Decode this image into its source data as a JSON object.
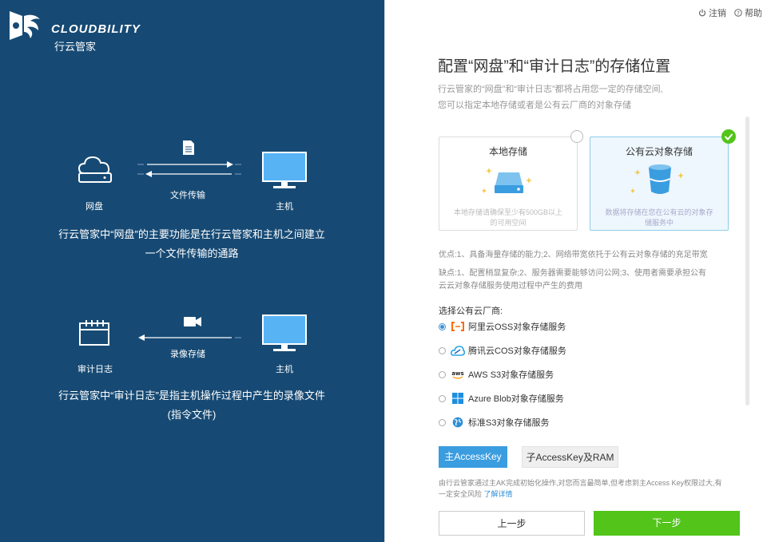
{
  "brand": {
    "name_en": "CLOUDBILITY",
    "name_cn": "行云管家"
  },
  "left": {
    "disk_flow": {
      "left_label": "网盘",
      "arrow_label": "文件传输",
      "right_label": "主机",
      "desc_line1": "行云管家中“网盘”的主要功能是在行云管家和主机之间建立",
      "desc_line2": "一个文件传输的通路"
    },
    "audit_flow": {
      "left_label": "审计日志",
      "arrow_label": "录像存储",
      "right_label": "主机",
      "desc_line1": "行云管家中“审计日志”是指主机操作过程中产生的录像文件",
      "desc_line2": "(指令文件)"
    }
  },
  "topbar": {
    "logout": "注销",
    "help": "帮助"
  },
  "main": {
    "title": "配置“网盘”和“审计日志”的存储位置",
    "subtitle_line1": "行云管家的“网盘”和“审计日志”都将占用您一定的存储空间,",
    "subtitle_line2": "您可以指定本地存储或者是公有云厂商的对象存储",
    "local": {
      "title": "本地存储",
      "desc_line1": "本地存储请确保至少有500GB以上",
      "desc_line2": "的可用空间"
    },
    "cloud": {
      "title": "公有云对象存储",
      "desc_line1": "数据将存储在您在公有云的对象存",
      "desc_line2": "储服务中"
    },
    "pros": "优点:1、具备海量存储的能力;2、网络带宽依托于公有云对象存储的充足带宽",
    "cons_line1": "缺点:1、配置稍显复杂;2、服务器需要能够访问公网;3、使用者需要承担公有",
    "cons_line2": "云云对象存储服务使用过程中产生的费用",
    "provider_head": "选择公有云厂商:",
    "providers": [
      {
        "label": "阿里云OSS对象存储服务",
        "icon": "aliyun-icon"
      },
      {
        "label": "腾讯云COS对象存储服务",
        "icon": "tencent-cloud-icon"
      },
      {
        "label": "AWS S3对象存储服务",
        "icon": "aws-icon"
      },
      {
        "label": "Azure Blob对象存储服务",
        "icon": "windows-icon"
      },
      {
        "label": "标准S3对象存储服务",
        "icon": "globe-icon"
      }
    ],
    "ak_main": "主AccessKey",
    "ak_sub": "子AccessKey及RAM",
    "note_line1": "由行云管家通过主AK完成初始化操作,对您而言最简单,但考虑到主Access Key权限过大,有",
    "note_line2": "一定安全风险",
    "note_link": "了解详情",
    "prev": "上一步",
    "next": "下一步"
  },
  "colors": {
    "left_bg": "#164a74",
    "accent_blue": "#3a9de0",
    "green": "#52c41a",
    "monitor": "#58b3f5"
  }
}
